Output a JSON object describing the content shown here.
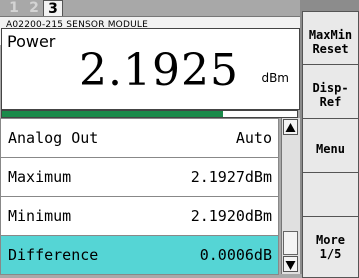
{
  "tabs": [
    "1",
    "2",
    "3"
  ],
  "active_tab": "3",
  "module_label": "A02200-215 SENSOR MODULE",
  "measurement": {
    "parameter": "Power",
    "value": "2.1925",
    "unit": "dBm"
  },
  "level_bar": {
    "fill_fraction": 0.75,
    "color": "#1a8a4a"
  },
  "rows": [
    {
      "label": "Analog Out",
      "value": "Auto",
      "selected": false
    },
    {
      "label": "Maximum",
      "value": "2.1927dBm",
      "selected": false
    },
    {
      "label": "Minimum",
      "value": "2.1920dBm",
      "selected": false
    },
    {
      "label": "Difference",
      "value": "0.0006dB",
      "selected": true
    }
  ],
  "softkeys": [
    {
      "line1": "MaxMin",
      "line2": "Reset"
    },
    {
      "line1": "Disp-",
      "line2": "Ref"
    },
    {
      "line1": "Menu",
      "line2": ""
    },
    {
      "line1": "",
      "line2": ""
    },
    {
      "line1": "More",
      "line2": "1/5"
    }
  ],
  "colors": {
    "selected_row": "#55d5d5",
    "background": "#a8a8a8"
  }
}
